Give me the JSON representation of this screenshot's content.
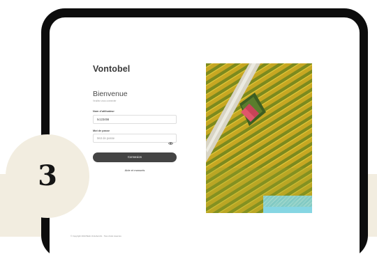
{
  "login": {
    "brand": "Vontobel",
    "welcome_title": "Bienvenue",
    "welcome_subtitle": "Veuillez vous connecter",
    "username_label": "Nom d'utilisateur",
    "username_value": "tv123456",
    "password_label": "Mot de passe",
    "password_placeholder": "Mot de passe",
    "submit_label": "Connexion",
    "help_link": "Aide et manuels",
    "copyright": "© Copyright 2024 Bank Vontobel AG · Tous droits réservés"
  },
  "badge": {
    "number": "3"
  },
  "colors": {
    "device_frame": "#0d0d0d",
    "button": "#444444",
    "badge_bg": "#f2ede0",
    "band_bg": "#f2ede0",
    "roof": "#e0566b",
    "overlay_cyan": "#7fd3e0",
    "field_yellow": "#d2b62a"
  },
  "icons": {
    "password_toggle": "eye-icon"
  }
}
